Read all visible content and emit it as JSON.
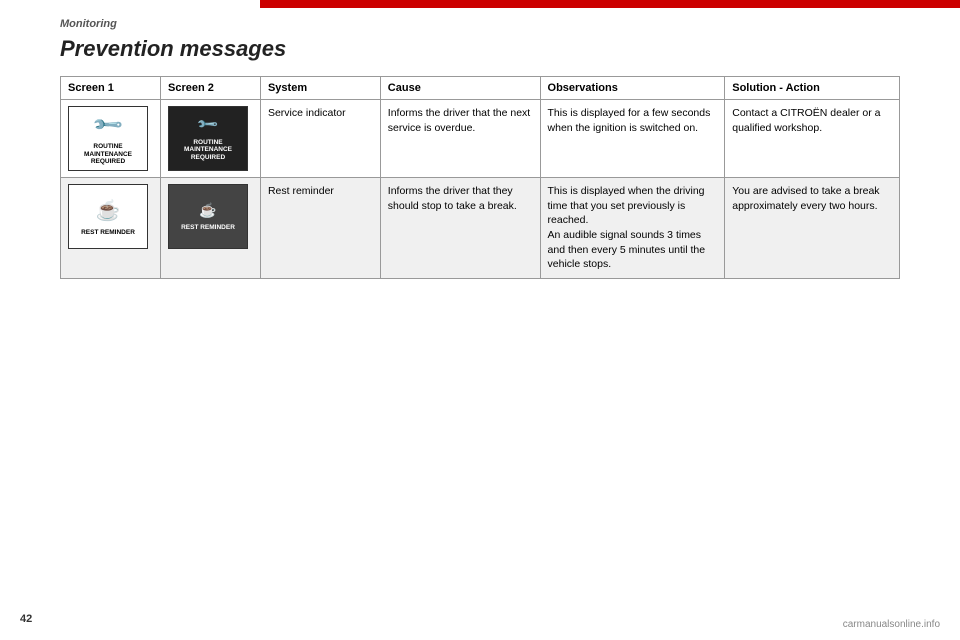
{
  "header": {
    "section_label": "Monitoring",
    "red_bar": true
  },
  "page_title": "Prevention messages",
  "page_number": "42",
  "watermark": "carmanualsonline.info",
  "table": {
    "columns": [
      {
        "id": "screen1",
        "label": "Screen 1"
      },
      {
        "id": "screen2",
        "label": "Screen 2"
      },
      {
        "id": "system",
        "label": "System"
      },
      {
        "id": "cause",
        "label": "Cause"
      },
      {
        "id": "observations",
        "label": "Observations"
      },
      {
        "id": "solution",
        "label": "Solution - Action"
      }
    ],
    "rows": [
      {
        "id": "row1",
        "screen1_text": "ROUTINE MAINTENANCE\nREQUIRED",
        "screen1_icon": "wrench",
        "screen2_text": "ROUTINE MAINTENANCE\nREQUIRED",
        "screen2_icon": "wrench",
        "system": "Service indicator",
        "cause": "Informs the driver that the next service is overdue.",
        "observations": "This is displayed for a few seconds when the ignition is switched on.",
        "solution": "Contact a CITROËN dealer or a qualified workshop."
      },
      {
        "id": "row2",
        "screen1_text": "REST REMINDER",
        "screen1_icon": "cup",
        "screen2_text": "REST REMINDER",
        "screen2_icon": "cup",
        "system": "Rest reminder",
        "cause": "Informs the driver that they should stop to take a break.",
        "observations": "This is displayed when the driving time that you set previously is reached.\nAn audible signal sounds 3 times and then every 5 minutes until the vehicle stops.",
        "solution": "You are advised to take a break approximately every two hours."
      }
    ]
  }
}
